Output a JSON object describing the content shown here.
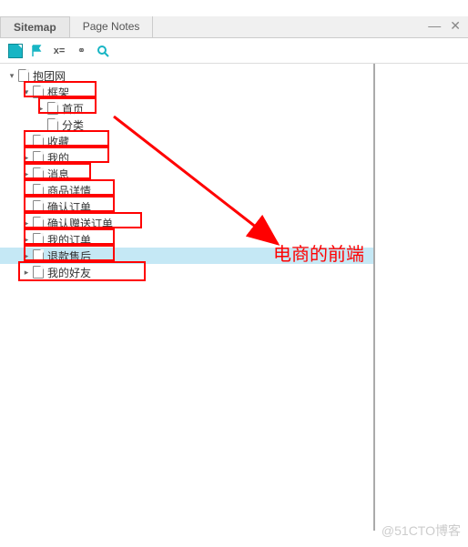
{
  "window": {
    "minimize": "—",
    "close": "✕"
  },
  "tabs": {
    "sitemap": "Sitemap",
    "page_notes": "Page Notes"
  },
  "toolbar": {
    "xeq": "x=",
    "link": "⚭"
  },
  "tree": {
    "root": "抱团网",
    "items": [
      {
        "label": "框架",
        "level": 2,
        "expander": "▾",
        "boxed": true
      },
      {
        "label": "首页",
        "level": 3,
        "expander": "▸",
        "boxed": true
      },
      {
        "label": "分类",
        "level": 3,
        "expander": "",
        "boxed": false
      },
      {
        "label": "收藏",
        "level": 2,
        "expander": "",
        "boxed": true
      },
      {
        "label": "我的",
        "level": 2,
        "expander": "▸",
        "boxed": true
      },
      {
        "label": "消息",
        "level": 2,
        "expander": "▸",
        "boxed": true
      },
      {
        "label": "商品详情",
        "level": 2,
        "expander": "",
        "boxed": true
      },
      {
        "label": "确认订单",
        "level": 2,
        "expander": "",
        "boxed": true
      },
      {
        "label": "确认赠送订单",
        "level": 2,
        "expander": "▸",
        "boxed": true
      },
      {
        "label": "我的订单",
        "level": 2,
        "expander": "▸",
        "boxed": true
      },
      {
        "label": "退款售后",
        "level": 2,
        "expander": "▸",
        "boxed": true,
        "highlighted": true
      },
      {
        "label": "我的好友",
        "level": 2,
        "expander": "▸",
        "boxed": true
      }
    ]
  },
  "annotation": "电商的前端",
  "watermark": "@51CTO博客"
}
